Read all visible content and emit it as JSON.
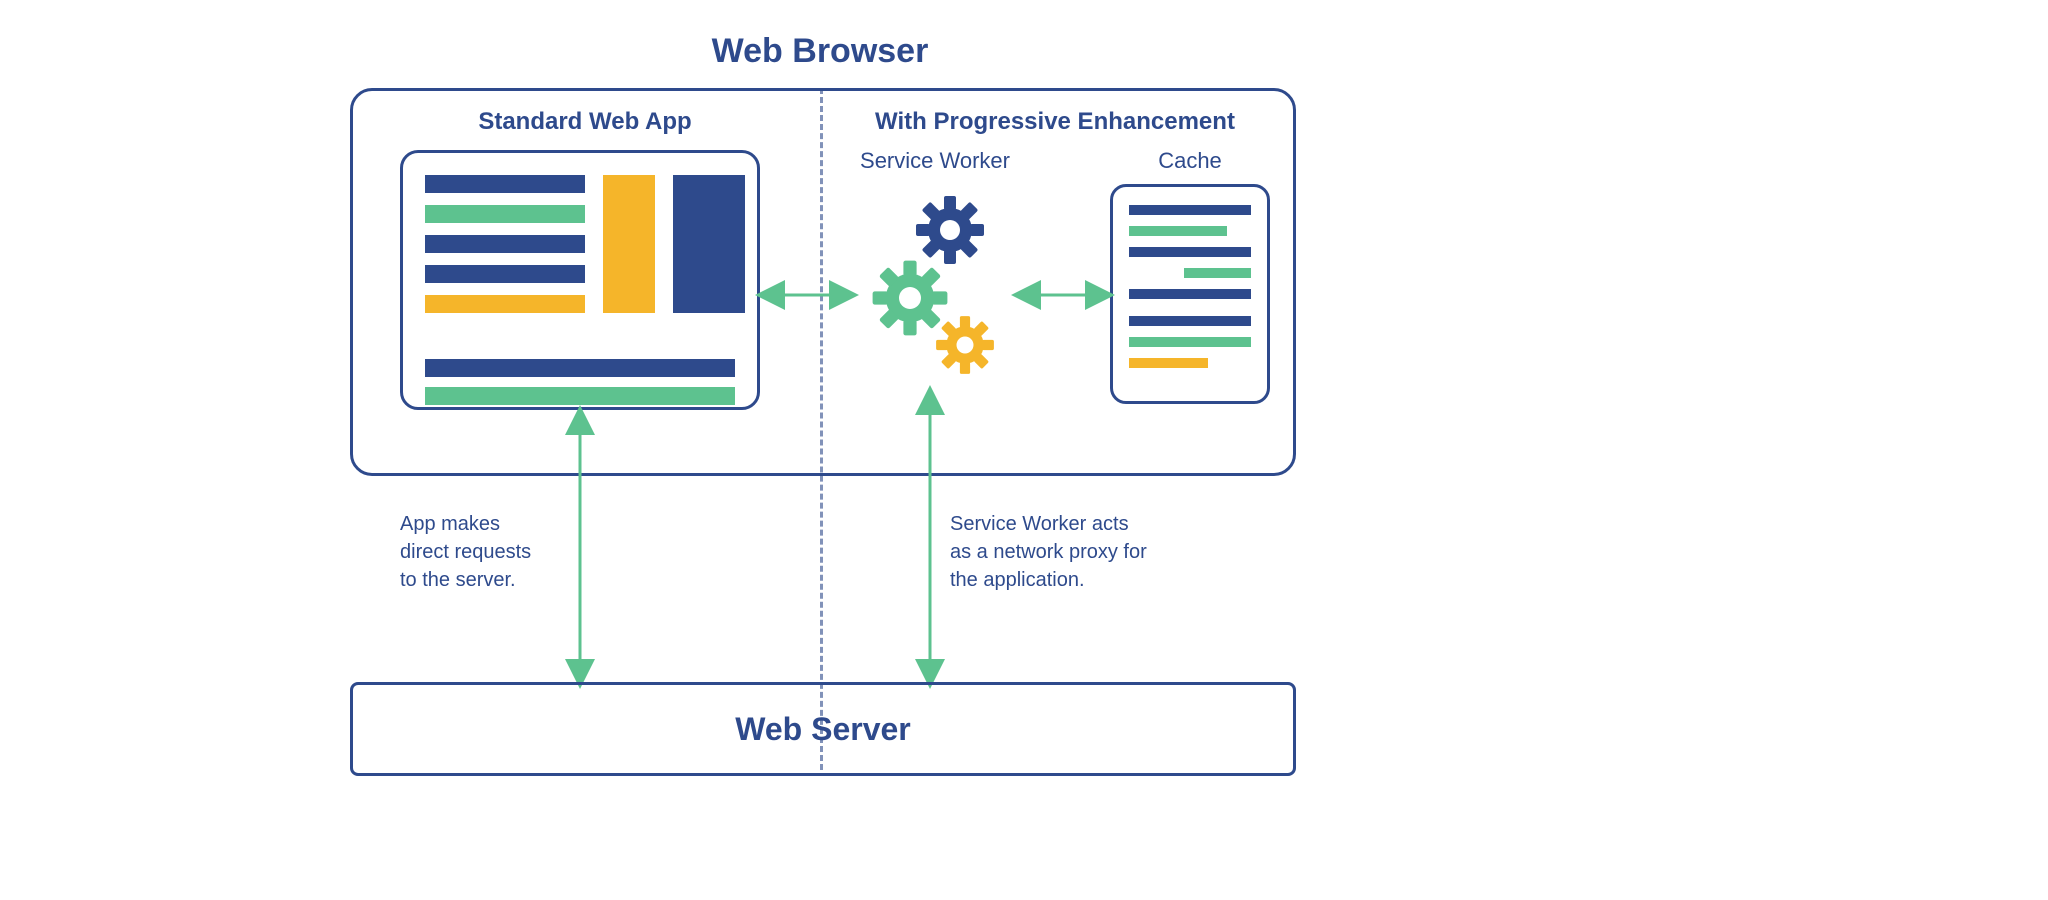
{
  "title": "Web Browser",
  "left": {
    "heading": "Standard Web App",
    "caption": "App makes\ndirect requests\nto the server."
  },
  "right": {
    "heading": "With Progressive Enhancement",
    "service_worker_label": "Service Worker",
    "cache_label": "Cache",
    "caption": "Service Worker acts\nas a network proxy for\nthe application."
  },
  "server": "Web Server",
  "colors": {
    "navy": "#2E4A8C",
    "green": "#5DC28F",
    "yellow": "#F5B52A"
  },
  "icons": {
    "gear_navy": "gear-icon",
    "gear_green": "gear-icon",
    "gear_yellow": "gear-icon"
  }
}
